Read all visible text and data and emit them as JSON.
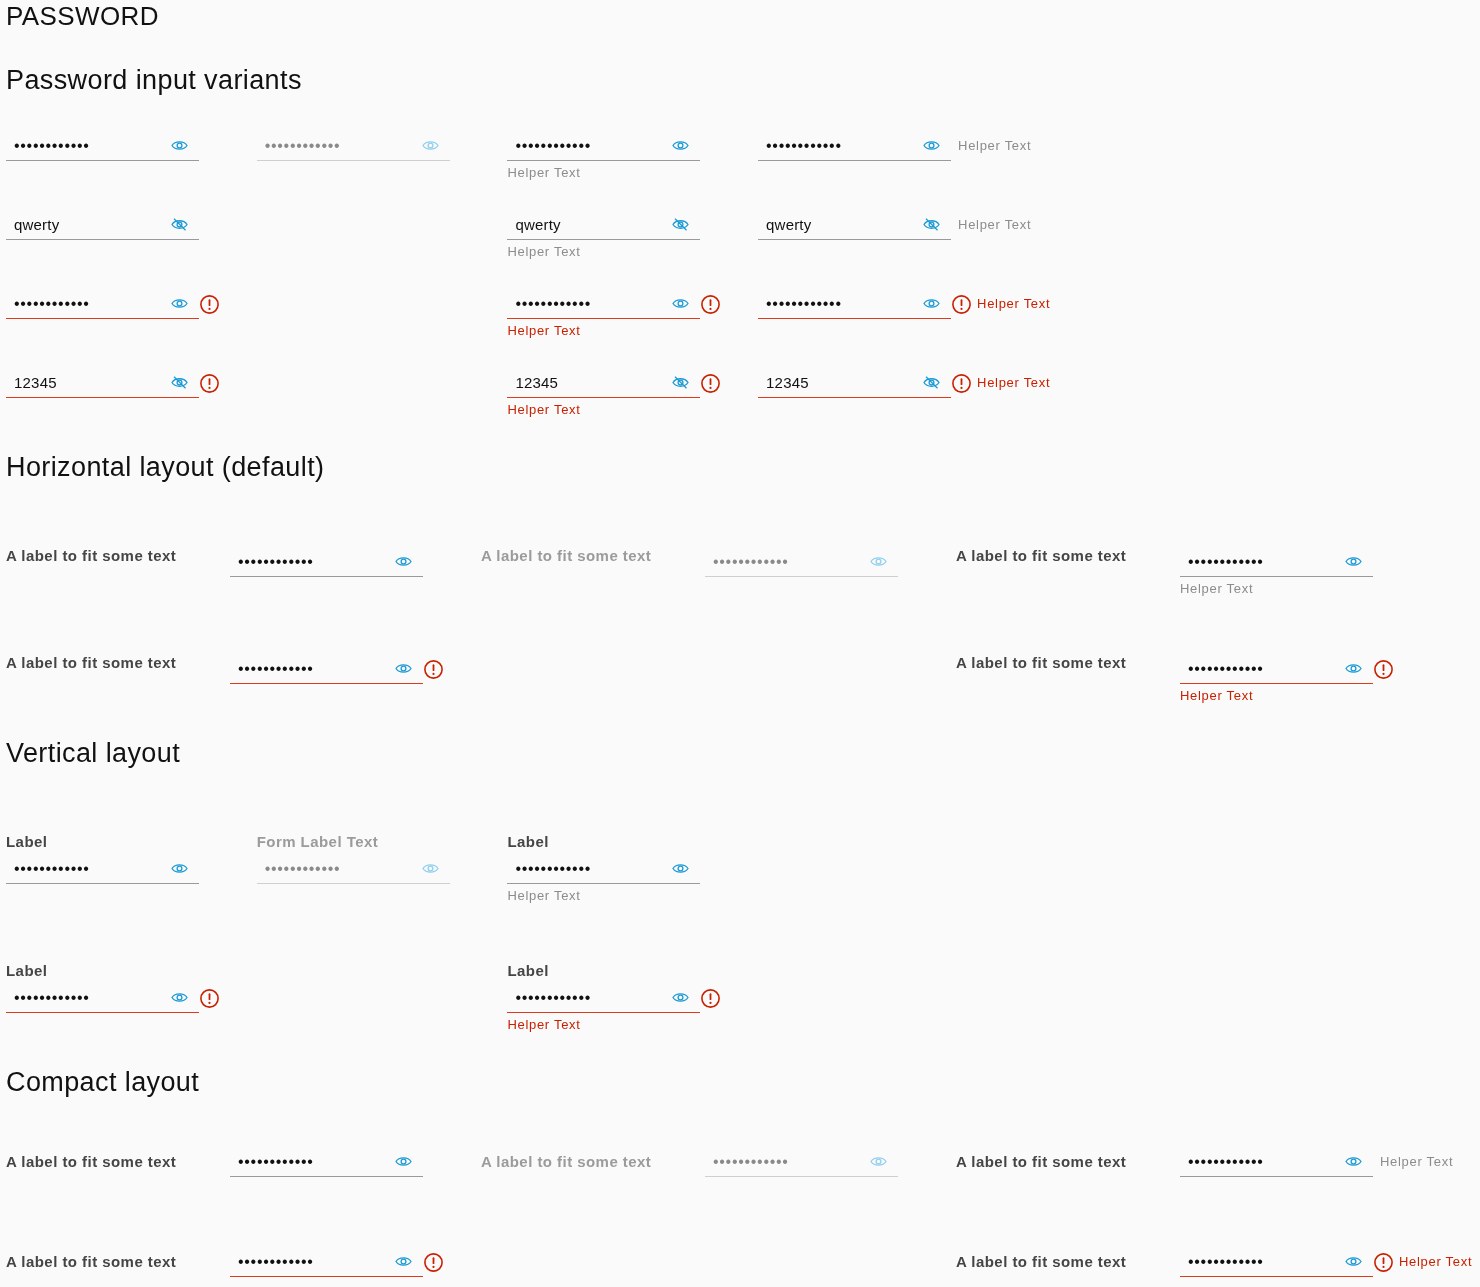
{
  "page_title": "PASSWORD",
  "sections": [
    {
      "title": "Password input variants",
      "kind": "stacked",
      "columns": [
        {
          "fields": [
            {
              "value": "••••••••••••",
              "revealed": false,
              "disabled": false,
              "error": false
            },
            {
              "value": "qwerty",
              "revealed": true,
              "disabled": false,
              "error": false
            },
            {
              "value": "••••••••••••",
              "revealed": false,
              "disabled": false,
              "error": true
            },
            {
              "value": "12345",
              "revealed": true,
              "disabled": false,
              "error": true
            }
          ]
        },
        {
          "fields": [
            {
              "value": "••••••••••••",
              "revealed": false,
              "disabled": true,
              "error": false
            }
          ]
        },
        {
          "fields": [
            {
              "value": "••••••••••••",
              "revealed": false,
              "disabled": false,
              "error": false,
              "helper_below": "Helper Text"
            },
            {
              "value": "qwerty",
              "revealed": true,
              "disabled": false,
              "error": false,
              "helper_below": "Helper Text"
            },
            {
              "value": "••••••••••••",
              "revealed": false,
              "disabled": false,
              "error": true,
              "helper_below": "Helper Text"
            },
            {
              "value": "12345",
              "revealed": true,
              "disabled": false,
              "error": true,
              "helper_below": "Helper Text"
            }
          ]
        },
        {
          "fields": [
            {
              "value": "••••••••••••",
              "revealed": false,
              "disabled": false,
              "error": false,
              "helper_right": "Helper Text"
            },
            {
              "value": "qwerty",
              "revealed": true,
              "disabled": false,
              "error": false,
              "helper_right": "Helper Text"
            },
            {
              "value": "••••••••••••",
              "revealed": false,
              "disabled": false,
              "error": true,
              "helper_right": "Helper Text"
            },
            {
              "value": "12345",
              "revealed": true,
              "disabled": false,
              "error": true,
              "helper_right": "Helper Text"
            }
          ]
        }
      ]
    },
    {
      "title": "Horizontal layout (default)",
      "kind": "horizontal",
      "columns": [
        {
          "fields": [
            {
              "label": "A label to fit some text",
              "value": "••••••••••••",
              "revealed": false,
              "disabled": false,
              "error": false
            },
            {
              "label": "A label to fit some text",
              "value": "••••••••••••",
              "revealed": false,
              "disabled": false,
              "error": true
            }
          ]
        },
        {
          "fields": [
            {
              "label": "A label to fit some text",
              "value": "••••••••••••",
              "revealed": false,
              "disabled": true,
              "error": false
            }
          ]
        },
        {
          "fields": [
            {
              "label": "A label to fit some text",
              "value": "••••••••••••",
              "revealed": false,
              "disabled": false,
              "error": false,
              "helper_below": "Helper Text"
            },
            {
              "label": "A label to fit some text",
              "value": "••••••••••••",
              "revealed": false,
              "disabled": false,
              "error": true,
              "helper_below": "Helper Text"
            }
          ]
        }
      ]
    },
    {
      "title": "Vertical layout",
      "kind": "vertical",
      "columns": [
        {
          "fields": [
            {
              "label": "Label",
              "value": "••••••••••••",
              "revealed": false,
              "disabled": false,
              "error": false
            },
            {
              "label": "Label",
              "value": "••••••••••••",
              "revealed": false,
              "disabled": false,
              "error": true
            }
          ]
        },
        {
          "fields": [
            {
              "label": "Form Label Text",
              "value": "••••••••••••",
              "revealed": false,
              "disabled": true,
              "error": false
            }
          ]
        },
        {
          "fields": [
            {
              "label": "Label",
              "value": "••••••••••••",
              "revealed": false,
              "disabled": false,
              "error": false,
              "helper_below": "Helper Text"
            },
            {
              "label": "Label",
              "value": "••••••••••••",
              "revealed": false,
              "disabled": false,
              "error": true,
              "helper_below": "Helper Text"
            }
          ]
        }
      ]
    },
    {
      "title": "Compact layout",
      "kind": "compact",
      "columns": [
        {
          "fields": [
            {
              "label": "A label to fit some text",
              "value": "••••••••••••",
              "revealed": false,
              "disabled": false,
              "error": false
            },
            {
              "label": "A label to fit some text",
              "value": "••••••••••••",
              "revealed": false,
              "disabled": false,
              "error": true
            }
          ]
        },
        {
          "fields": [
            {
              "label": "A label to fit some text",
              "value": "••••••••••••",
              "revealed": false,
              "disabled": true,
              "error": false
            }
          ]
        },
        {
          "fields": [
            {
              "label": "A label to fit some text",
              "value": "••••••••••••",
              "revealed": false,
              "disabled": false,
              "error": false,
              "helper_right": "Helper Text"
            },
            {
              "label": "A label to fit some text",
              "value": "••••••••••••",
              "revealed": false,
              "disabled": false,
              "error": true,
              "helper_right": "Helper Text"
            }
          ]
        }
      ]
    }
  ]
}
